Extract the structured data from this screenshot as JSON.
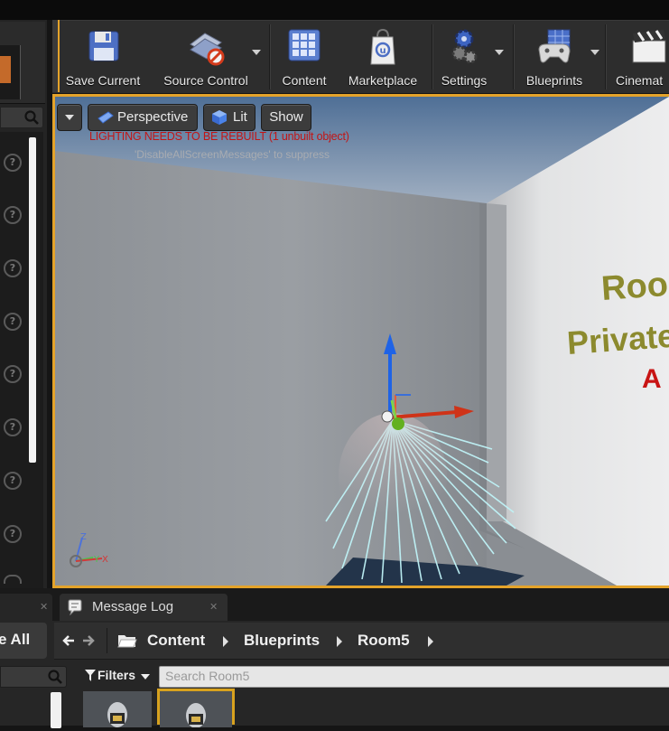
{
  "toolbar": {
    "buttons": [
      {
        "label": "Save Current",
        "icon": "floppy-disk-icon"
      },
      {
        "label": "Source Control",
        "icon": "source-control-icon"
      },
      {
        "label": "Content",
        "icon": "content-grid-icon"
      },
      {
        "label": "Marketplace",
        "icon": "marketplace-bag-icon"
      },
      {
        "label": "Settings",
        "icon": "settings-gears-icon"
      },
      {
        "label": "Blueprints",
        "icon": "blueprints-gamepad-icon"
      },
      {
        "label": "Cinemat",
        "icon": "clapperboard-icon"
      }
    ]
  },
  "viewport": {
    "view_mode": "Perspective",
    "lighting_mode": "Lit",
    "show_label": "Show",
    "warning": "LIGHTING NEEDS TO BE REBUILT (1 unbuilt object)",
    "suppress_hint": "'DisableAllScreenMessages' to suppress",
    "wall_text_line1": "Room",
    "wall_text_line2": "Private V",
    "wall_text_line3": "A",
    "axis_labels": {
      "z": "Z",
      "y": "Y",
      "x": "X"
    }
  },
  "tabs": {
    "message_log": "Message Log"
  },
  "content_browser": {
    "save_all": "e All",
    "breadcrumbs": [
      "Content",
      "Blueprints",
      "Room5"
    ],
    "filters_label": "Filters",
    "search_placeholder": "Search Room5"
  },
  "colors": {
    "accent": "#e4a32a",
    "warning": "#c31515",
    "wall_text": "#8c8a2e",
    "wall_letter": "#c81414"
  }
}
